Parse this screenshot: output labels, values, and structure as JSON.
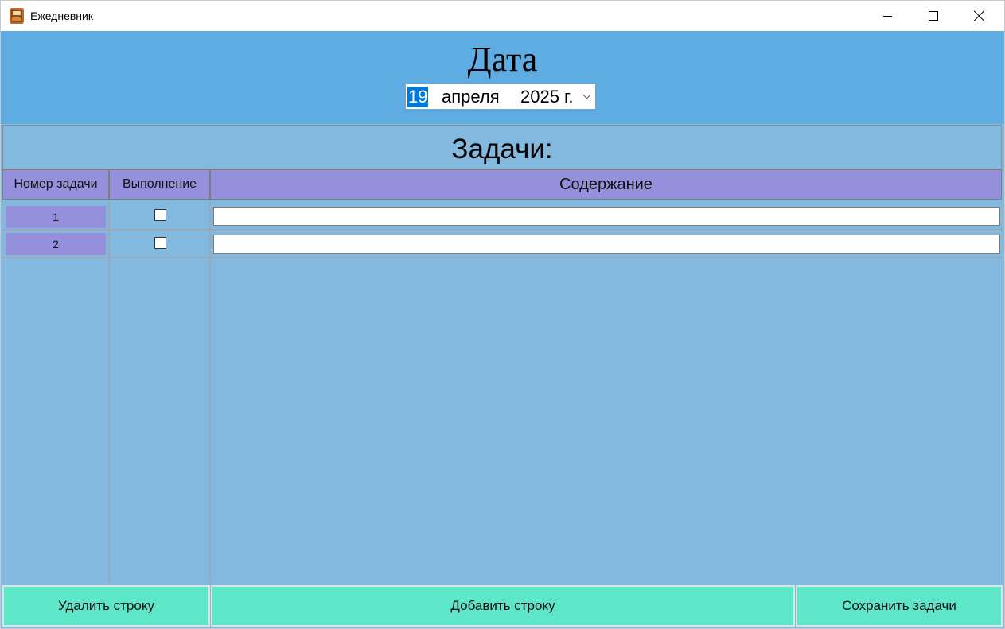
{
  "window": {
    "title": "Ежедневник",
    "controls": {
      "minimize": "minimize-icon",
      "maximize": "maximize-icon",
      "close": "close-icon"
    }
  },
  "header": {
    "title": "Дата",
    "date": {
      "day": "19",
      "month": "апреля",
      "year": "2025 г."
    }
  },
  "tasks": {
    "title": "Задачи:",
    "columns": {
      "number": "Номер задачи",
      "done": "Выполнение",
      "content": "Содержание"
    },
    "rows": [
      {
        "number": "1",
        "done": false,
        "content": ""
      },
      {
        "number": "2",
        "done": false,
        "content": ""
      }
    ]
  },
  "buttons": {
    "delete": "Удалить строку",
    "add": "Добавить строку",
    "save": "Сохранить задачи"
  },
  "colors": {
    "header_bg": "#5eace2",
    "panel_bg": "#83b9de",
    "column_header_bg": "#9490dc",
    "button_bg": "#5ee6c9",
    "selection": "#0078d7"
  }
}
